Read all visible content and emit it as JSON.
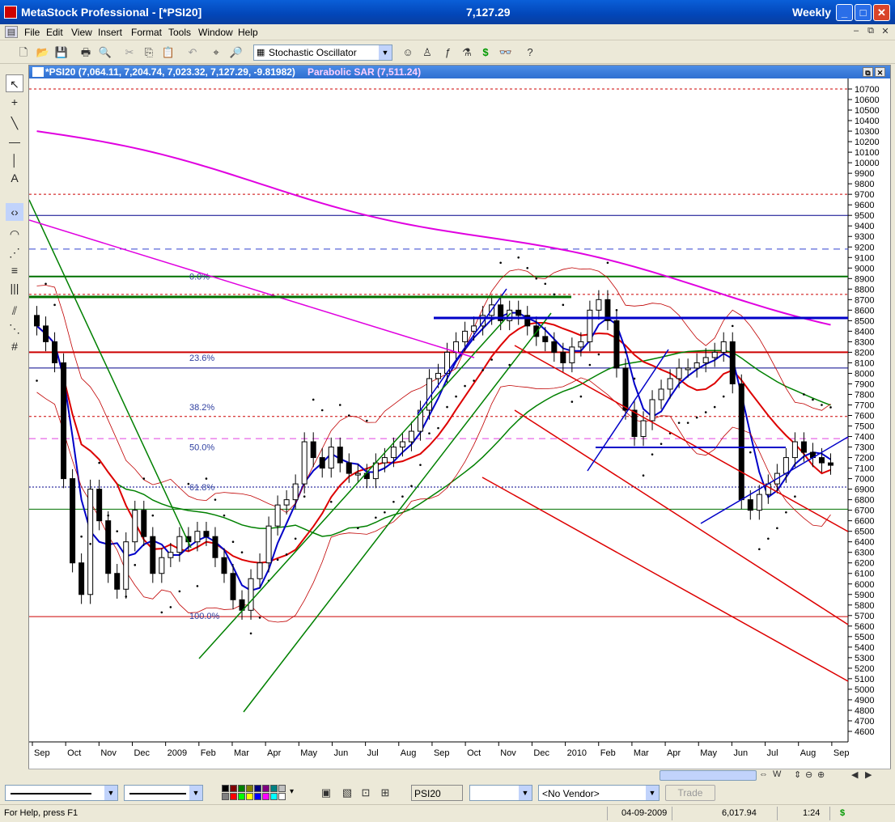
{
  "window": {
    "title": "MetaStock Professional - [*PSI20]",
    "price": "7,127.29",
    "period": "Weekly"
  },
  "menu": [
    "File",
    "Edit",
    "View",
    "Insert",
    "Format",
    "Tools",
    "Window",
    "Help"
  ],
  "toolbar": {
    "indicator": "Stochastic Oscillator"
  },
  "chart": {
    "security_header": "*PSI20 (7,064.11, 7,204.74, 7,023.32, 7,127.29, -9.81982)",
    "indicator_header": "Parabolic SAR (7,511.24)"
  },
  "chart_data": {
    "type": "candlestick",
    "symbol": "PSI20",
    "frequency": "Weekly",
    "ylim": [
      4500,
      10800
    ],
    "y_ticks": [
      4600,
      4700,
      4800,
      4900,
      5000,
      5100,
      5200,
      5300,
      5400,
      5500,
      5600,
      5700,
      5800,
      5900,
      6000,
      6100,
      6200,
      6300,
      6400,
      6500,
      6600,
      6700,
      6800,
      6900,
      7000,
      7100,
      7200,
      7300,
      7400,
      7500,
      7600,
      7700,
      7800,
      7900,
      8000,
      8100,
      8200,
      8300,
      8400,
      8500,
      8600,
      8700,
      8800,
      8900,
      9000,
      9100,
      9200,
      9300,
      9400,
      9500,
      9600,
      9700,
      9800,
      9900,
      10000,
      10100,
      10200,
      10300,
      10400,
      10500,
      10600,
      10700
    ],
    "x_ticks": [
      "Sep",
      "Oct",
      "Nov",
      "Dec",
      "2009",
      "Feb",
      "Mar",
      "Apr",
      "May",
      "Jun",
      "Jul",
      "Aug",
      "Sep",
      "Oct",
      "Nov",
      "Dec",
      "2010",
      "Feb",
      "Mar",
      "Apr",
      "May",
      "Jun",
      "Jul",
      "Aug",
      "Sep"
    ],
    "fibonacci": [
      {
        "label": "0.0%",
        "value": 8920
      },
      {
        "label": "23.6%",
        "value": 8150
      },
      {
        "label": "38.2%",
        "value": 7680
      },
      {
        "label": "50.0%",
        "value": 7300
      },
      {
        "label": "61.8%",
        "value": 6920
      },
      {
        "label": "100.0%",
        "value": 5700
      }
    ],
    "close": [
      8450,
      8300,
      8100,
      7000,
      6200,
      5900,
      6900,
      6600,
      6100,
      5950,
      6400,
      6700,
      6450,
      6100,
      6250,
      6300,
      6450,
      6400,
      6500,
      6450,
      6250,
      6100,
      5850,
      5750,
      6050,
      6200,
      6550,
      6750,
      6800,
      6950,
      7350,
      7200,
      7100,
      7300,
      7150,
      7050,
      7050,
      7000,
      7150,
      7200,
      7300,
      7350,
      7450,
      7650,
      7950,
      8000,
      8200,
      8300,
      8400,
      8450,
      8550,
      8650,
      8500,
      8600,
      8550,
      8450,
      8350,
      8300,
      8200,
      8100,
      8250,
      8300,
      8600,
      8700,
      8500,
      8050,
      7650,
      7400,
      7550,
      7750,
      7850,
      7950,
      8050,
      8050,
      8100,
      8150,
      8200,
      8300,
      7900,
      6800,
      6700,
      6850,
      6950,
      7050,
      7200,
      7350,
      7250,
      7200,
      7150,
      7127
    ],
    "parabolic_sar": "7,511.24",
    "last_bar": {
      "open": 7064.11,
      "high": 7204.74,
      "low": 7023.32,
      "close": 7127.29,
      "change": -9.81982
    }
  },
  "bottom": {
    "symbol": "PSI20",
    "vendor": "<No Vendor>",
    "trade": "Trade",
    "palette": [
      "#000000",
      "#800000",
      "#008000",
      "#808000",
      "#000080",
      "#800080",
      "#008080",
      "#c0c0c0",
      "#808080",
      "#ff0000",
      "#00ff00",
      "#ffff00",
      "#0000ff",
      "#ff00ff",
      "#00ffff",
      "#ffffff"
    ]
  },
  "status": {
    "help": "For Help, press F1",
    "date": "04-09-2009",
    "value": "6,017.94",
    "time": "1:24",
    "currency": "$"
  },
  "colors": {
    "blue_ma": "#0000c8",
    "red_ma": "#dd0000",
    "green_ma": "#008000",
    "magenta_ma": "#e000e0",
    "bollinger": "#c00000"
  }
}
